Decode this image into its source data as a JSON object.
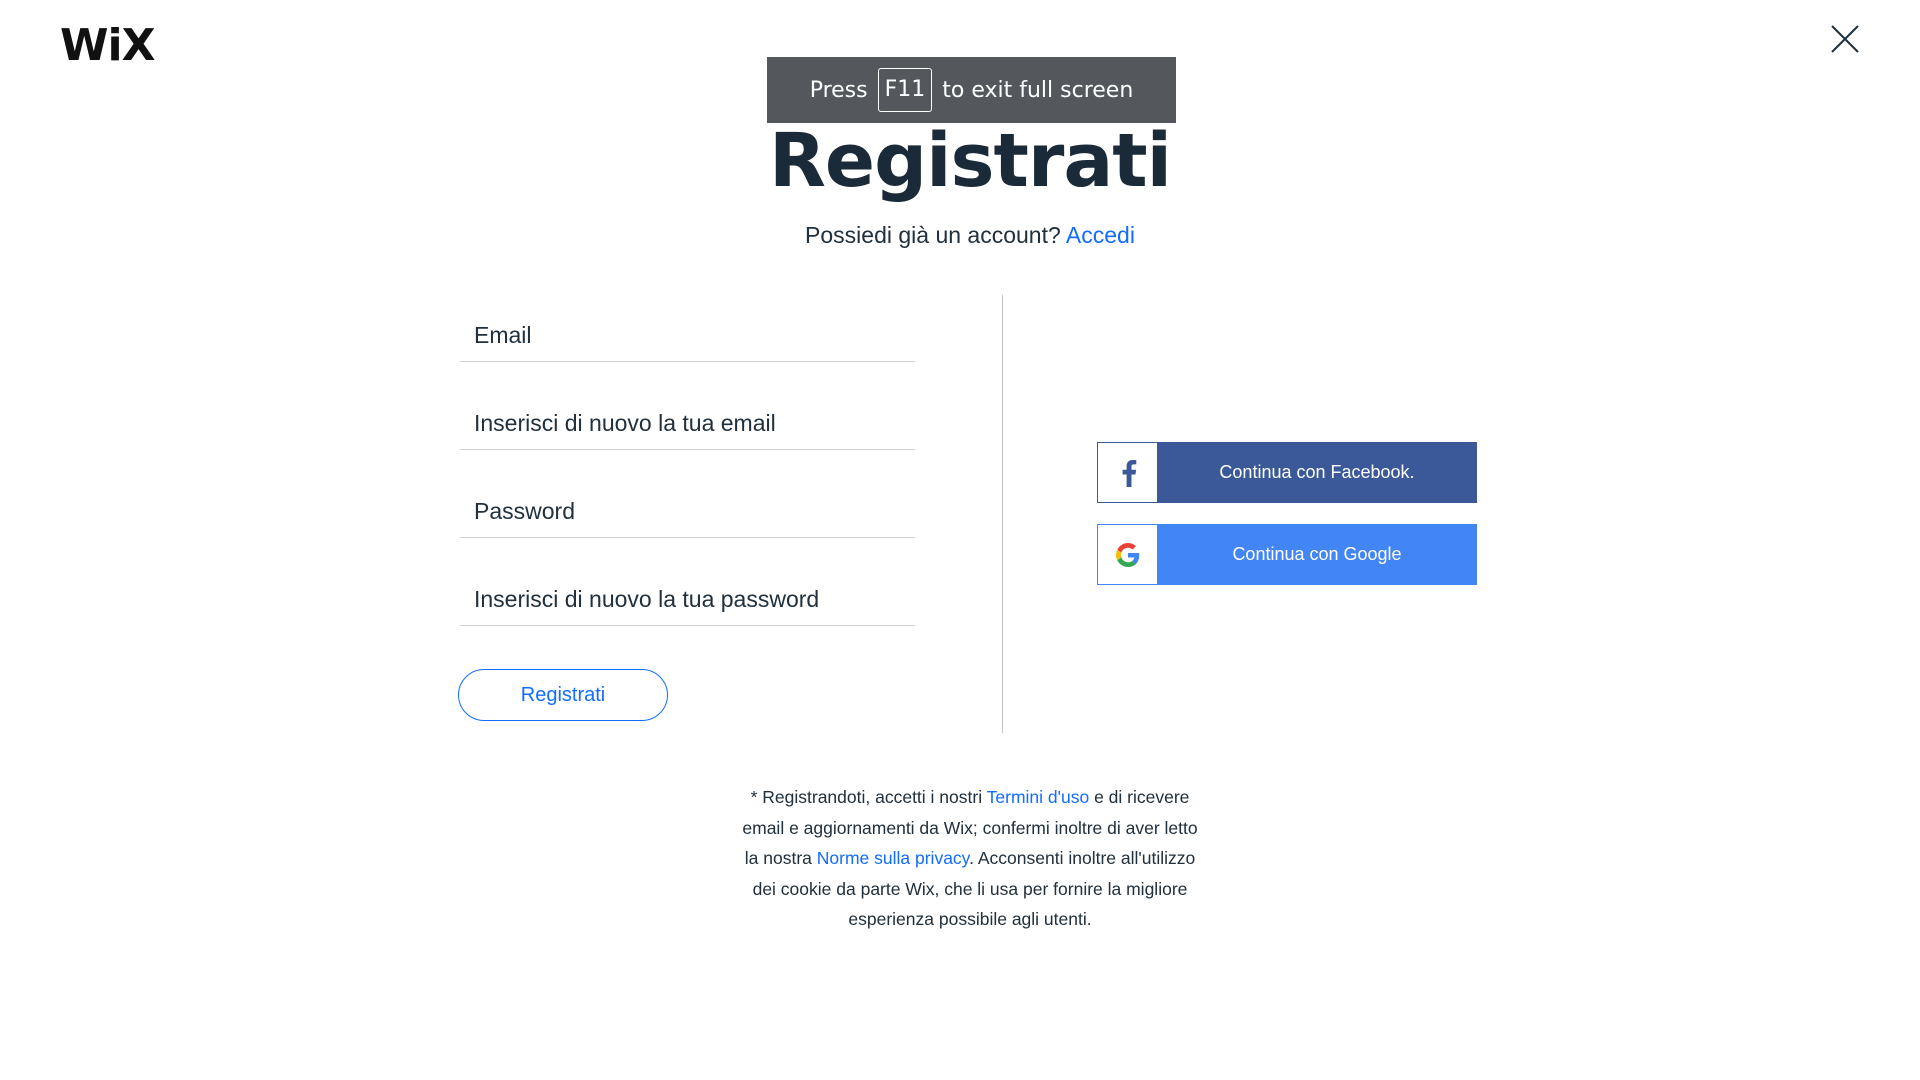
{
  "brand": {
    "logo_text": "WiX"
  },
  "fullscreen_toast": {
    "prefix": "Press",
    "key": "F11",
    "suffix": "to exit full screen"
  },
  "header": {
    "title": "Registrati",
    "subtitle_text": "Possiedi già un account?",
    "login_link": "Accedi"
  },
  "form": {
    "email_placeholder": "Email",
    "email_confirm_placeholder": "Inserisci di nuovo la tua email",
    "password_placeholder": "Password",
    "password_confirm_placeholder": "Inserisci di nuovo la tua password",
    "submit_label": "Registrati"
  },
  "social": {
    "facebook_label": "Continua con Facebook.",
    "google_label": "Continua con Google"
  },
  "legal": {
    "part1": "* Registrandoti, accetti i nostri ",
    "terms_link": "Termini d'uso",
    "part2": " e di ricevere email e aggiornamenti da Wix; confermi inoltre di aver letto la nostra ",
    "privacy_link": "Norme sulla privacy",
    "part3": ". Acconsenti inoltre all'utilizzo dei cookie da parte Wix, che li usa per fornire la migliore esperienza possibile agli utenti."
  },
  "icons": [
    "close-icon",
    "facebook-icon",
    "google-icon"
  ],
  "colors": {
    "accent": "#116dff",
    "facebook": "#3b5998",
    "google": "#4285f4",
    "title": "#1b2a38",
    "toast": "#54585c"
  }
}
